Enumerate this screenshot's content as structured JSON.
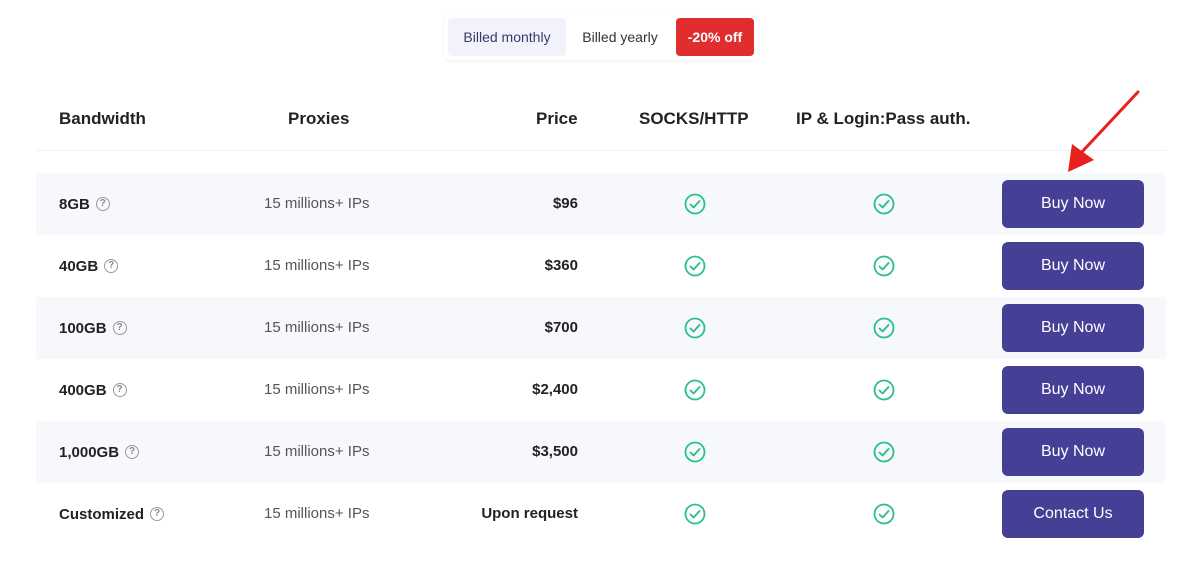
{
  "billing": {
    "monthly_label": "Billed monthly",
    "yearly_label": "Billed yearly",
    "discount_badge": "-20% off"
  },
  "table": {
    "headers": {
      "bandwidth": "Bandwidth",
      "proxies": "Proxies",
      "price": "Price",
      "socks": "SOCKS/HTTP",
      "auth": "IP & Login:Pass auth."
    },
    "rows": [
      {
        "bandwidth": "8GB",
        "proxies": "15 millions+ IPs",
        "price": "$96",
        "action": "Buy Now"
      },
      {
        "bandwidth": "40GB",
        "proxies": "15 millions+ IPs",
        "price": "$360",
        "action": "Buy Now"
      },
      {
        "bandwidth": "100GB",
        "proxies": "15 millions+ IPs",
        "price": "$700",
        "action": "Buy Now"
      },
      {
        "bandwidth": "400GB",
        "proxies": "15 millions+ IPs",
        "price": "$2,400",
        "action": "Buy Now"
      },
      {
        "bandwidth": "1,000GB",
        "proxies": "15 millions+ IPs",
        "price": "$3,500",
        "action": "Buy Now"
      },
      {
        "bandwidth": "Customized",
        "proxies": "15 millions+ IPs",
        "price": "Upon request",
        "action": "Contact Us"
      }
    ]
  },
  "icons": {
    "info": "question-circle-icon",
    "check": "check-circle-icon",
    "annotation": "red-arrow-icon"
  },
  "colors": {
    "button": "#453f96",
    "badge": "#e02d2d",
    "check": "#2bbf8a",
    "arrow": "#e8201e"
  }
}
